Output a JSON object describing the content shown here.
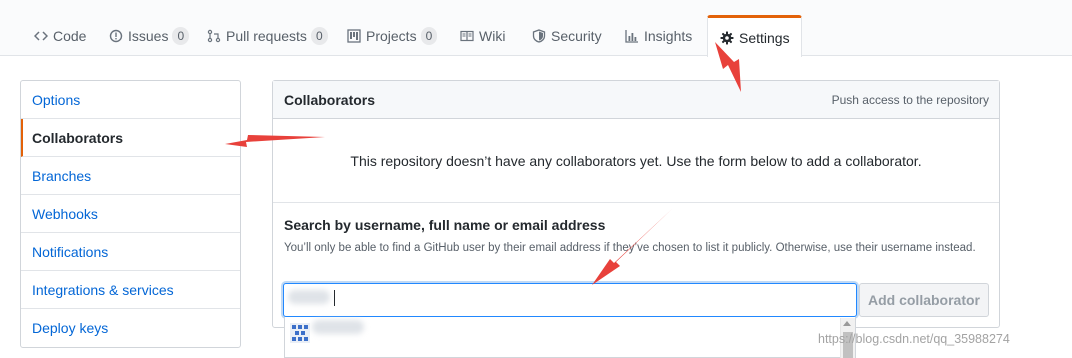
{
  "tabs": [
    {
      "label": "Code",
      "icon": "code-icon"
    },
    {
      "label": "Issues",
      "icon": "issue-opened-icon",
      "count": "0"
    },
    {
      "label": "Pull requests",
      "icon": "git-pull-request-icon",
      "count": "0"
    },
    {
      "label": "Projects",
      "icon": "project-icon",
      "count": "0"
    },
    {
      "label": "Wiki",
      "icon": "book-icon"
    },
    {
      "label": "Security",
      "icon": "shield-icon"
    },
    {
      "label": "Insights",
      "icon": "graph-icon"
    },
    {
      "label": "Settings",
      "icon": "gear-icon",
      "selected": true
    }
  ],
  "sidebar": {
    "items": [
      {
        "label": "Options"
      },
      {
        "label": "Collaborators",
        "selected": true
      },
      {
        "label": "Branches"
      },
      {
        "label": "Webhooks"
      },
      {
        "label": "Notifications"
      },
      {
        "label": "Integrations & services"
      },
      {
        "label": "Deploy keys"
      }
    ]
  },
  "collaborators": {
    "title": "Collaborators",
    "note": "Push access to the repository",
    "blank_message": "This repository doesn’t have any collaborators yet. Use the form below to add a collaborator.",
    "search_label": "Search by username, full name or email address",
    "search_help": "You’ll only be able to find a GitHub user by their email address if they’ve chosen to list it publicly. Otherwise, use their username instead.",
    "search_value": "",
    "add_button": "Add collaborator"
  },
  "watermark": "https://blog.csdn.net/qq_35988274",
  "colors": {
    "accent_orange": "#e36209",
    "link_blue": "#0366d6",
    "annotation_red": "#e8413b"
  }
}
